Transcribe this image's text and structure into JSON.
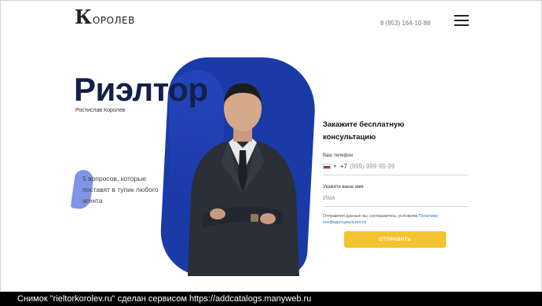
{
  "header": {
    "logo_initial": "К",
    "logo_rest": "ОРОЛЕВ",
    "phone": "8 (953) 164-10-88",
    "menu_icon": "hamburger-icon"
  },
  "hero": {
    "title": "Риэлтор",
    "name": "Ростислав Королев",
    "questions_text": "5 вопросов, которые поставят в тупик любого агента"
  },
  "form": {
    "title": "Закажите бесплатную консультацию",
    "phone_label": "Ваш телефон",
    "phone_prefix": "+7",
    "phone_placeholder": "(999) 999-99-99",
    "name_label": "Укажите ваше имя",
    "name_placeholder": "Имя",
    "consent_text": "Отправляя данные вы соглашаетесь условиям",
    "consent_link": "Политики конфиденциальности",
    "submit_label": "ОТПРАВИТЬ"
  },
  "footer": {
    "caption": "Снимок \"rieltorkorolev.ru\" сделан сервисом https://addcatalogs.manyweb.ru"
  },
  "colors": {
    "accent_blue": "#1a3aa8",
    "button_yellow": "#f4c430",
    "title_navy": "#132049",
    "link_blue": "#2e79c4"
  }
}
